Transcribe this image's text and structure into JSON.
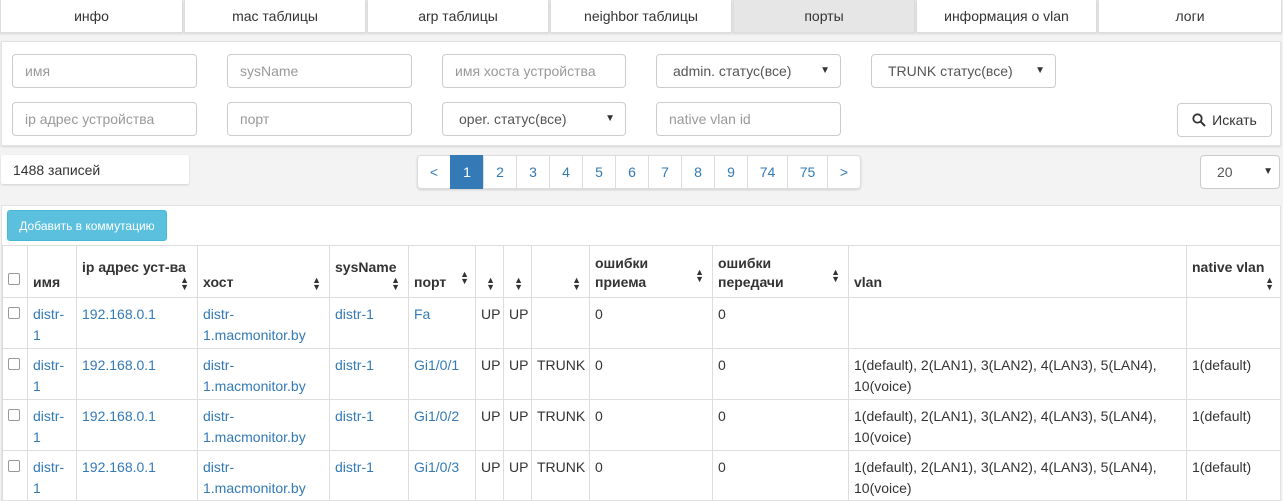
{
  "tabs": [
    {
      "label": "инфо",
      "active": false
    },
    {
      "label": "mac таблицы",
      "active": false
    },
    {
      "label": "arp таблицы",
      "active": false
    },
    {
      "label": "neighbor таблицы",
      "active": false
    },
    {
      "label": "порты",
      "active": true
    },
    {
      "label": "информация о vlan",
      "active": false
    },
    {
      "label": "логи",
      "active": false
    }
  ],
  "filters": {
    "name_placeholder": "имя",
    "sysname_placeholder": "sysName",
    "hostname_placeholder": "имя хоста устройства",
    "admin_status": "admin. статус(все)",
    "trunk_status": "TRUNK статус(все)",
    "ip_placeholder": "ip адрес устройства",
    "port_placeholder": "порт",
    "oper_status": "oper. статус(все)",
    "native_vlan_placeholder": "native vlan id",
    "search_label": "Искать"
  },
  "records_label": "1488 записей",
  "pagination": {
    "prev": "<",
    "next": ">",
    "pages": [
      "1",
      "2",
      "3",
      "4",
      "5",
      "6",
      "7",
      "8",
      "9",
      "74",
      "75"
    ],
    "active": "1"
  },
  "page_size": "20",
  "add_button": "Добавить в коммутацию",
  "table": {
    "headers": {
      "name": "имя",
      "ip": "ip адрес уст-ва",
      "host": "хост",
      "sysname": "sysName",
      "port": "порт",
      "rx_errors": "ошибки приема",
      "tx_errors": "ошибки передачи",
      "vlan": "vlan",
      "native_vlan": "native vlan"
    },
    "rows": [
      {
        "name": "distr-1",
        "ip": "192.168.0.1",
        "host": "distr-1.macmonitor.by",
        "sysname": "distr-1",
        "port": "Fa",
        "admin": "UP",
        "oper": "UP",
        "trunk": "",
        "rx": "0",
        "tx": "0",
        "vlan": "",
        "native": ""
      },
      {
        "name": "distr-1",
        "ip": "192.168.0.1",
        "host": "distr-1.macmonitor.by",
        "sysname": "distr-1",
        "port": "Gi1/0/1",
        "admin": "UP",
        "oper": "UP",
        "trunk": "TRUNK",
        "rx": "0",
        "tx": "0",
        "vlan": "1(default), 2(LAN1), 3(LAN2), 4(LAN3), 5(LAN4), 10(voice)",
        "native": "1(default)"
      },
      {
        "name": "distr-1",
        "ip": "192.168.0.1",
        "host": "distr-1.macmonitor.by",
        "sysname": "distr-1",
        "port": "Gi1/0/2",
        "admin": "UP",
        "oper": "UP",
        "trunk": "TRUNK",
        "rx": "0",
        "tx": "0",
        "vlan": "1(default), 2(LAN1), 3(LAN2), 4(LAN3), 5(LAN4), 10(voice)",
        "native": "1(default)"
      },
      {
        "name": "distr-1",
        "ip": "192.168.0.1",
        "host": "distr-1.macmonitor.by",
        "sysname": "distr-1",
        "port": "Gi1/0/3",
        "admin": "UP",
        "oper": "UP",
        "trunk": "TRUNK",
        "rx": "0",
        "tx": "0",
        "vlan": "1(default), 2(LAN1), 3(LAN2), 4(LAN3), 5(LAN4), 10(voice)",
        "native": "1(default)"
      }
    ]
  }
}
